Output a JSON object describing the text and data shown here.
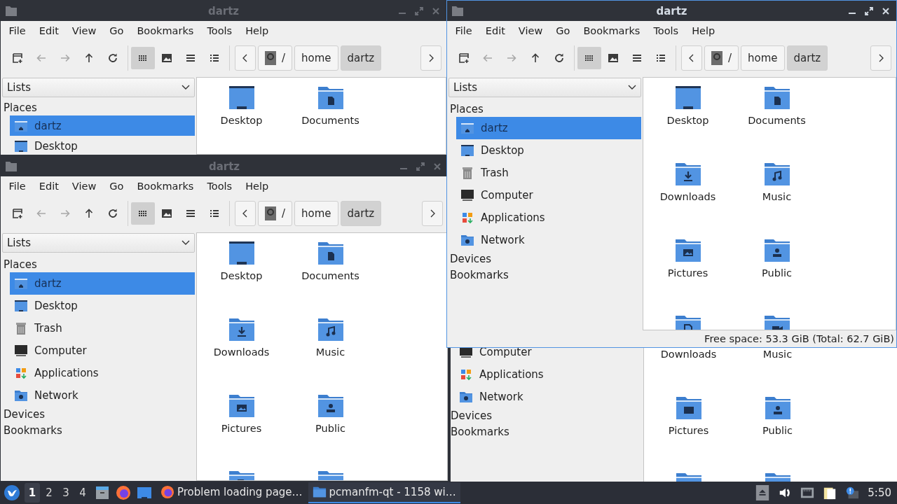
{
  "background_window": {
    "sidebar": [
      {
        "label": "Computer",
        "kind": "computer",
        "selected": false
      },
      {
        "label": "Applications",
        "kind": "applications",
        "selected": false
      },
      {
        "label": "Network",
        "kind": "network",
        "selected": false
      }
    ],
    "sections": [
      "Devices",
      "Bookmarks"
    ],
    "files": [
      {
        "name": "Downloads",
        "kind": "caption"
      },
      {
        "name": "Music",
        "kind": "caption"
      },
      {
        "name": "Pictures",
        "kind": "pictures"
      },
      {
        "name": "Public",
        "kind": "public"
      },
      {
        "kind": "templates"
      },
      {
        "kind": "videos"
      }
    ]
  },
  "windows": [
    {
      "title": "dartz",
      "active": false,
      "menu": [
        "File",
        "Edit",
        "View",
        "Go",
        "Bookmarks",
        "Tools",
        "Help"
      ],
      "nav_buttons": [
        {
          "kind": "new-tab",
          "disabled": false
        },
        {
          "kind": "back",
          "disabled": true
        },
        {
          "kind": "forward",
          "disabled": true
        },
        {
          "kind": "up",
          "disabled": false
        },
        {
          "kind": "reload",
          "disabled": false
        }
      ],
      "view_buttons": [
        {
          "kind": "icons",
          "selected": true
        },
        {
          "kind": "thumbnails",
          "selected": false
        },
        {
          "kind": "compact",
          "selected": false
        },
        {
          "kind": "details",
          "selected": false
        }
      ],
      "path": [
        {
          "label": "/",
          "selected": false
        },
        {
          "label": "home",
          "selected": false
        },
        {
          "label": "dartz",
          "selected": true
        }
      ],
      "side_pane": "Lists",
      "places_header": "Places",
      "places": [
        {
          "label": "dartz",
          "kind": "home",
          "selected": true
        },
        {
          "label": "Desktop",
          "kind": "desktop",
          "selected": false
        }
      ],
      "files": [
        {
          "name": "Desktop",
          "kind": "desktop"
        },
        {
          "name": "Documents",
          "kind": "documents"
        }
      ]
    },
    {
      "title": "dartz",
      "active": false,
      "menu": [
        "File",
        "Edit",
        "View",
        "Go",
        "Bookmarks",
        "Tools",
        "Help"
      ],
      "nav_buttons": [
        {
          "kind": "new-tab",
          "disabled": false
        },
        {
          "kind": "back",
          "disabled": true
        },
        {
          "kind": "forward",
          "disabled": true
        },
        {
          "kind": "up",
          "disabled": false
        },
        {
          "kind": "reload",
          "disabled": false
        }
      ],
      "view_buttons": [
        {
          "kind": "icons",
          "selected": true
        },
        {
          "kind": "thumbnails",
          "selected": false
        },
        {
          "kind": "compact",
          "selected": false
        },
        {
          "kind": "details",
          "selected": false
        }
      ],
      "path": [
        {
          "label": "/",
          "selected": false
        },
        {
          "label": "home",
          "selected": false
        },
        {
          "label": "dartz",
          "selected": true
        }
      ],
      "side_pane": "Lists",
      "places_header": "Places",
      "places": [
        {
          "label": "dartz",
          "kind": "home",
          "selected": true
        },
        {
          "label": "Desktop",
          "kind": "desktop",
          "selected": false
        },
        {
          "label": "Trash",
          "kind": "trash",
          "selected": false
        },
        {
          "label": "Computer",
          "kind": "computer",
          "selected": false
        },
        {
          "label": "Applications",
          "kind": "applications",
          "selected": false
        },
        {
          "label": "Network",
          "kind": "network",
          "selected": false
        }
      ],
      "sections": [
        "Devices",
        "Bookmarks"
      ],
      "files": [
        {
          "name": "Desktop",
          "kind": "desktop"
        },
        {
          "name": "Documents",
          "kind": "documents"
        },
        {
          "name": "Downloads",
          "kind": "downloads"
        },
        {
          "name": "Music",
          "kind": "music"
        },
        {
          "name": "Pictures",
          "kind": "pictures"
        },
        {
          "name": "Public",
          "kind": "public"
        },
        {
          "kind": "templates"
        },
        {
          "kind": "videos"
        }
      ]
    },
    {
      "title": "dartz",
      "active": true,
      "menu": [
        "File",
        "Edit",
        "View",
        "Go",
        "Bookmarks",
        "Tools",
        "Help"
      ],
      "nav_buttons": [
        {
          "kind": "new-tab",
          "disabled": false
        },
        {
          "kind": "back",
          "disabled": true
        },
        {
          "kind": "forward",
          "disabled": true
        },
        {
          "kind": "up",
          "disabled": false
        },
        {
          "kind": "reload",
          "disabled": false
        }
      ],
      "view_buttons": [
        {
          "kind": "icons",
          "selected": true
        },
        {
          "kind": "thumbnails",
          "selected": false
        },
        {
          "kind": "compact",
          "selected": false
        },
        {
          "kind": "details",
          "selected": false
        }
      ],
      "path": [
        {
          "label": "/",
          "selected": false
        },
        {
          "label": "home",
          "selected": false
        },
        {
          "label": "dartz",
          "selected": true
        }
      ],
      "side_pane": "Lists",
      "places_header": "Places",
      "places": [
        {
          "label": "dartz",
          "kind": "home",
          "selected": true
        },
        {
          "label": "Desktop",
          "kind": "desktop",
          "selected": false
        },
        {
          "label": "Trash",
          "kind": "trash",
          "selected": false
        },
        {
          "label": "Computer",
          "kind": "computer",
          "selected": false
        },
        {
          "label": "Applications",
          "kind": "applications",
          "selected": false
        },
        {
          "label": "Network",
          "kind": "network",
          "selected": false
        }
      ],
      "sections": [
        "Devices",
        "Bookmarks"
      ],
      "files": [
        {
          "name": "Desktop",
          "kind": "desktop"
        },
        {
          "name": "Documents",
          "kind": "documents"
        },
        {
          "name": "Downloads",
          "kind": "downloads"
        },
        {
          "name": "Music",
          "kind": "music"
        },
        {
          "name": "Pictures",
          "kind": "pictures"
        },
        {
          "name": "Public",
          "kind": "public"
        },
        {
          "kind": "templates"
        },
        {
          "kind": "videos"
        }
      ],
      "status": "Free space: 53.3 GiB (Total: 62.7 GiB)"
    }
  ],
  "taskbar": {
    "desktops": [
      {
        "label": "1",
        "selected": true
      },
      {
        "label": "2",
        "selected": false
      },
      {
        "label": "3",
        "selected": false
      },
      {
        "label": "4",
        "selected": false
      }
    ],
    "launchers": [
      {
        "kind": "cabinet"
      },
      {
        "kind": "firefox"
      },
      {
        "kind": "desktop"
      }
    ],
    "tasks": [
      {
        "label": "Problem loading page…",
        "kind": "firefox",
        "selected": false
      },
      {
        "label": "pcmanfm-qt - 1158 wi…",
        "kind": "folder",
        "selected": true
      }
    ],
    "tray": [
      {
        "kind": "eject"
      },
      {
        "kind": "volume"
      },
      {
        "kind": "network"
      },
      {
        "kind": "clipboard"
      },
      {
        "kind": "notification"
      }
    ],
    "clock": "5:50"
  }
}
